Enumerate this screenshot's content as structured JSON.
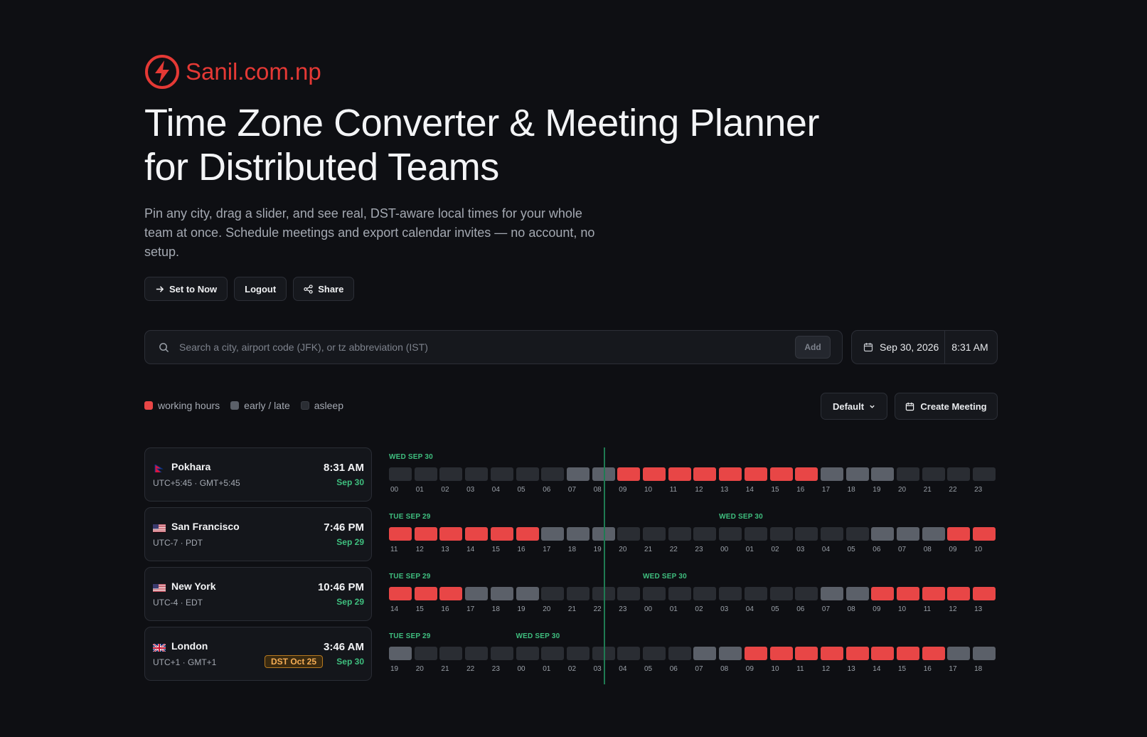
{
  "brand": {
    "name": "Sanil.com.np",
    "logo_icon": "bolt-circle-icon",
    "color": "#e53935"
  },
  "hero": {
    "title": "Time Zone Converter & Meeting Planner for Distributed Teams",
    "subtitle": "Pin any city, drag a slider, and see real, DST-aware local times for your whole team at once. Schedule meetings and export calendar invites — no account, no setup."
  },
  "actions": {
    "set_now": "Set to Now",
    "logout": "Logout",
    "share": "Share"
  },
  "search": {
    "placeholder": "Search a city, airport code (JFK), or tz abbreviation (IST)",
    "add_label": "Add"
  },
  "datetime": {
    "date": "Sep 30, 2026",
    "time": "8:31 AM"
  },
  "legend": {
    "working": "working hours",
    "early_late": "early / late",
    "asleep": "asleep",
    "colors": {
      "working": "#e84646",
      "early_late": "#5b6069",
      "asleep": "#2a2d33"
    }
  },
  "controls": {
    "sort": "Default",
    "create_meeting": "Create Meeting"
  },
  "cities": [
    {
      "name": "Pokhara",
      "flag": "nepal",
      "offset": "UTC+5:45 · GMT+5:45",
      "time": "8:31 AM",
      "date": "Sep 30",
      "day_labels": [
        {
          "text": "WED SEP 30",
          "start": 0
        }
      ],
      "hours": [
        "00",
        "01",
        "02",
        "03",
        "04",
        "05",
        "06",
        "07",
        "08",
        "09",
        "10",
        "11",
        "12",
        "13",
        "14",
        "15",
        "16",
        "17",
        "18",
        "19",
        "20",
        "21",
        "22",
        "23"
      ],
      "states": "aaaaaaaeewwwwwwwweeeaaaa"
    },
    {
      "name": "San Francisco",
      "flag": "us",
      "offset": "UTC-7 · PDT",
      "time": "7:46 PM",
      "date": "Sep 29",
      "day_labels": [
        {
          "text": "TUE SEP 29",
          "start": 0
        },
        {
          "text": "WED SEP 30",
          "start": 13
        }
      ],
      "hours": [
        "11",
        "12",
        "13",
        "14",
        "15",
        "16",
        "17",
        "18",
        "19",
        "20",
        "21",
        "22",
        "23",
        "00",
        "01",
        "02",
        "03",
        "04",
        "05",
        "06",
        "07",
        "08",
        "09",
        "10"
      ],
      "states": "wwwwwweeeaaaaaaaaaaeeeww"
    },
    {
      "name": "New York",
      "flag": "us",
      "offset": "UTC-4 · EDT",
      "time": "10:46 PM",
      "date": "Sep 29",
      "day_labels": [
        {
          "text": "TUE SEP 29",
          "start": 0
        },
        {
          "text": "WED SEP 30",
          "start": 10
        }
      ],
      "hours": [
        "14",
        "15",
        "16",
        "17",
        "18",
        "19",
        "20",
        "21",
        "22",
        "23",
        "00",
        "01",
        "02",
        "03",
        "04",
        "05",
        "06",
        "07",
        "08",
        "09",
        "10",
        "11",
        "12",
        "13"
      ],
      "states": "wwweeeaaaaaaaaaaaeewwwww"
    },
    {
      "name": "London",
      "flag": "uk",
      "offset": "UTC+1 · GMT+1",
      "time": "3:46 AM",
      "date": "Sep 30",
      "badge": "DST Oct 25",
      "day_labels": [
        {
          "text": "TUE SEP 29",
          "start": 0
        },
        {
          "text": "WED SEP 30",
          "start": 5
        }
      ],
      "hours": [
        "19",
        "20",
        "21",
        "22",
        "23",
        "00",
        "01",
        "02",
        "03",
        "04",
        "05",
        "06",
        "07",
        "08",
        "09",
        "10",
        "11",
        "12",
        "13",
        "14",
        "15",
        "16",
        "17",
        "18"
      ],
      "states": "eaaaaaaaaaaaeewwwwwwwwee"
    }
  ]
}
